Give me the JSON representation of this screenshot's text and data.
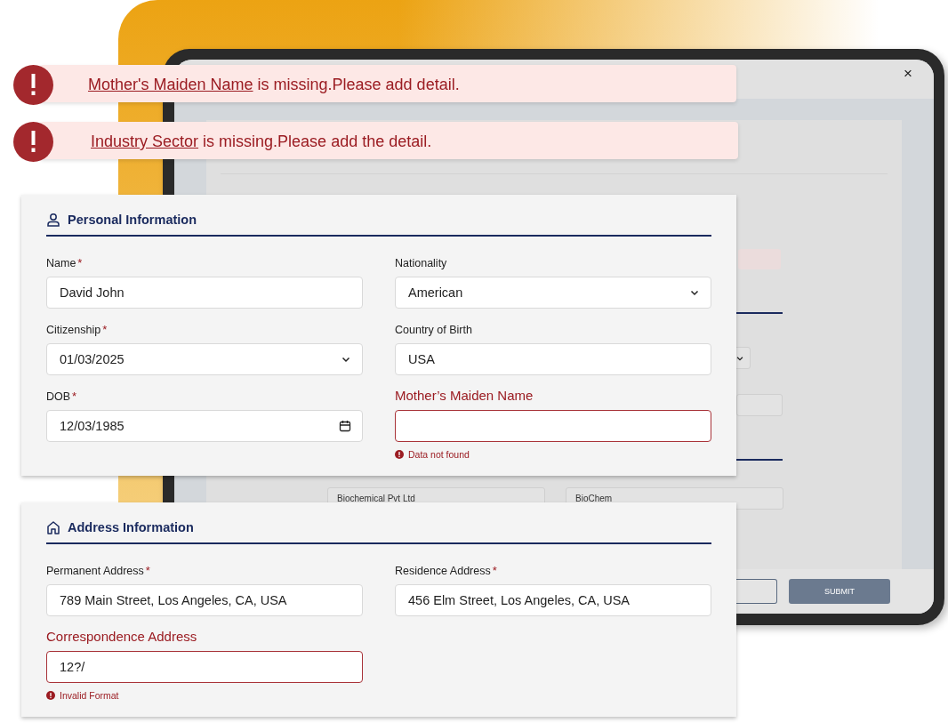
{
  "background_window": {
    "close": "×",
    "fields": [
      {
        "value": "Biochemical Pvt Ltd"
      },
      {
        "value": "BioChem"
      }
    ],
    "buttons": [
      {
        "kind": "outlined"
      },
      {
        "kind": "filled",
        "label": "SUBMIT"
      }
    ]
  },
  "alerts": [
    {
      "link": "Mother's Maiden Name",
      "message": "is missing.Please add detail."
    },
    {
      "link": "Industry Sector",
      "message": "is missing.Please add the detail."
    }
  ],
  "sections": [
    {
      "title": "Personal Information",
      "fields": [
        {
          "label": "Name",
          "required_mark": "*",
          "kind": "text",
          "value": "David John",
          "error": false
        },
        {
          "label": "Nationality",
          "kind": "select",
          "value": "American",
          "error": false
        },
        {
          "label": "Citizenship",
          "required_mark": "*",
          "kind": "select",
          "value": "01/03/2025",
          "error": false
        },
        {
          "label": "Country of Birth",
          "kind": "text",
          "value": "USA",
          "error": false
        },
        {
          "label": "DOB",
          "required_mark": "*",
          "kind": "date",
          "value": "12/03/1985",
          "error": false
        },
        {
          "label": "Mother’s Maiden Name",
          "kind": "text",
          "error": true,
          "error_message": "Data not found"
        }
      ]
    },
    {
      "title": "Address Information",
      "fields": [
        {
          "label": "Permanent Address",
          "required_mark": "*",
          "kind": "text",
          "value": "789 Main Street, Los Angeles, CA, USA",
          "error": false
        },
        {
          "label": "Residence Address",
          "required_mark": "*",
          "kind": "text",
          "value": "456 Elm Street, Los Angeles, CA, USA",
          "error": false
        },
        {
          "label": "Correspondence Address",
          "kind": "text",
          "value": "12?/",
          "error": true,
          "error_message": "Invalid Format"
        }
      ]
    }
  ]
}
